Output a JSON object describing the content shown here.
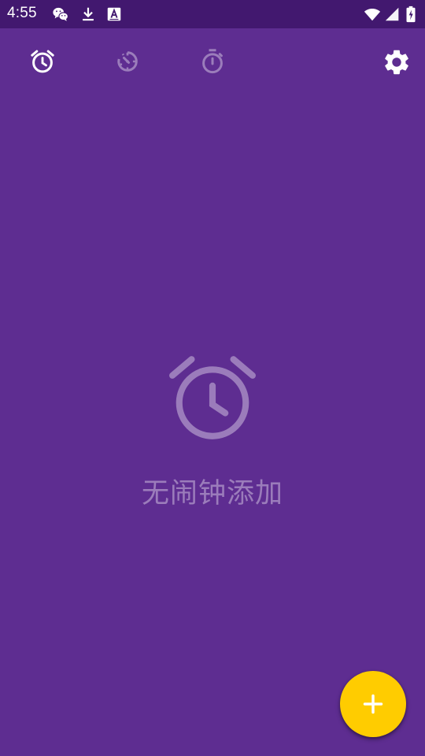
{
  "status_bar": {
    "time": "4:55",
    "left_icons": [
      "wechat-icon",
      "download-icon",
      "text-a-icon"
    ],
    "right_icons": [
      "wifi-icon",
      "cellular-signal-icon",
      "battery-charging-icon"
    ]
  },
  "toolbar": {
    "tabs": [
      {
        "name": "alarm",
        "icon": "alarm-clock-icon",
        "selected": true
      },
      {
        "name": "clock",
        "icon": "clock-dial-icon",
        "selected": false
      },
      {
        "name": "stopwatch",
        "icon": "stopwatch-icon",
        "selected": false
      }
    ],
    "settings_icon": "gear-icon"
  },
  "empty_state": {
    "icon": "alarm-clock-icon",
    "message": "无闹钟添加"
  },
  "fab": {
    "icon": "plus-icon"
  },
  "colors": {
    "background": "#5E2D91",
    "status_bar": "#42186F",
    "fab": "#FFCC00"
  }
}
